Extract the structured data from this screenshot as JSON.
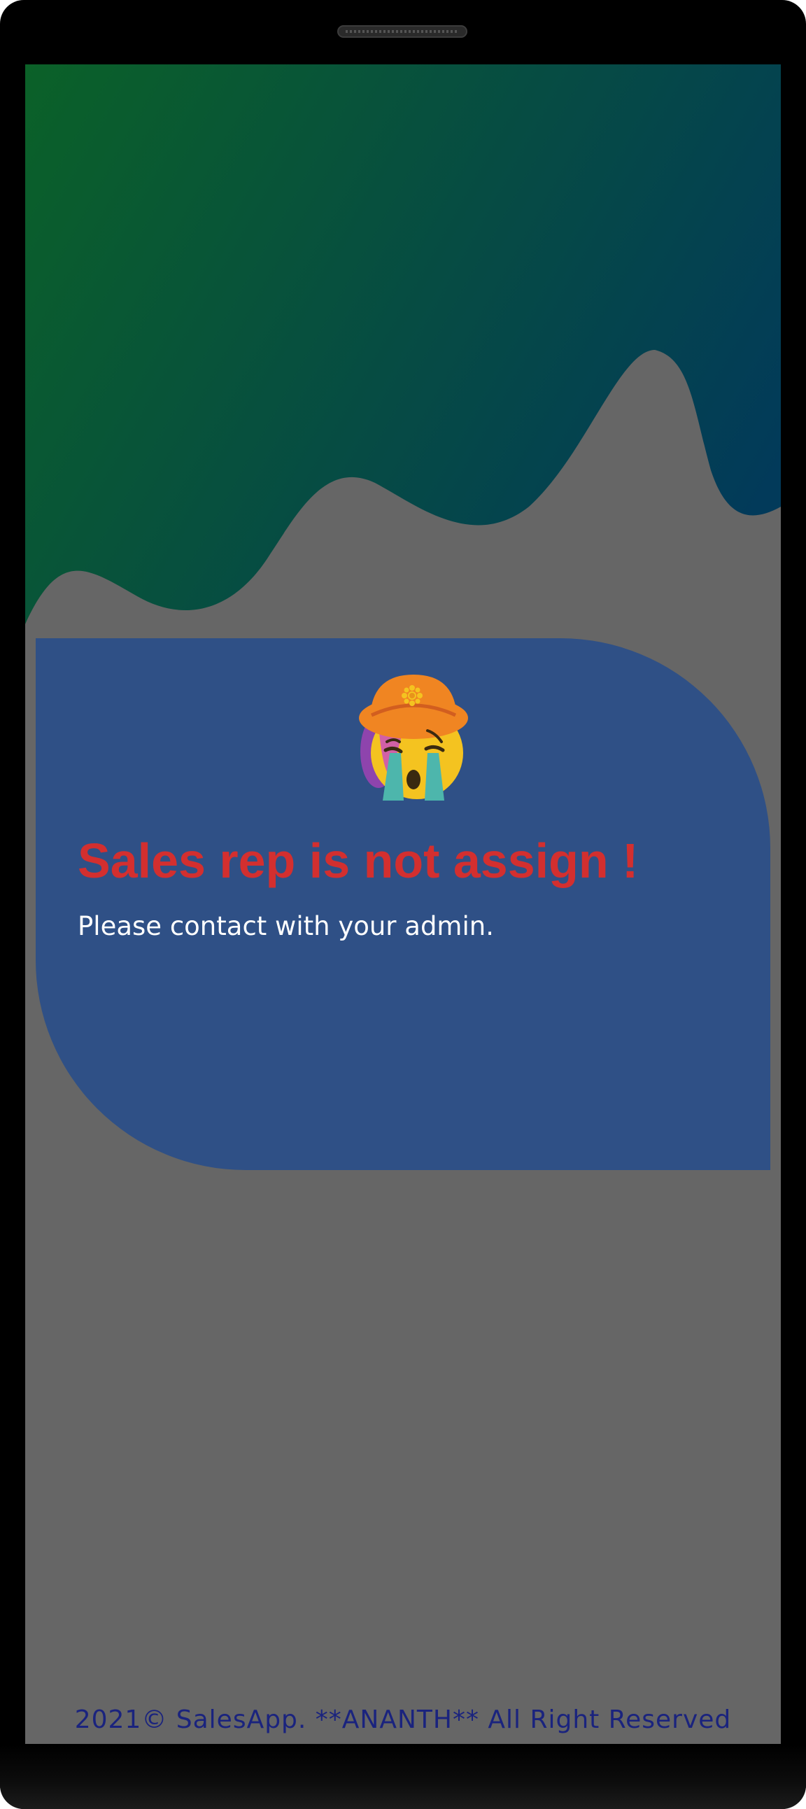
{
  "alert": {
    "title": "Sales rep is not assign !",
    "message": "Please contact with your admin.",
    "icon": "crying-face-emoji"
  },
  "footer": {
    "text": "2021© SalesApp. **ANANTH** All Right Reserved"
  },
  "colors": {
    "screen_background": "#666666",
    "gradient_start": "#0b6128",
    "gradient_end": "#023a5a",
    "card_background": "#2f5086",
    "title_color": "#d32f2f",
    "message_color": "#ffffff",
    "footer_color": "#1a237e"
  }
}
